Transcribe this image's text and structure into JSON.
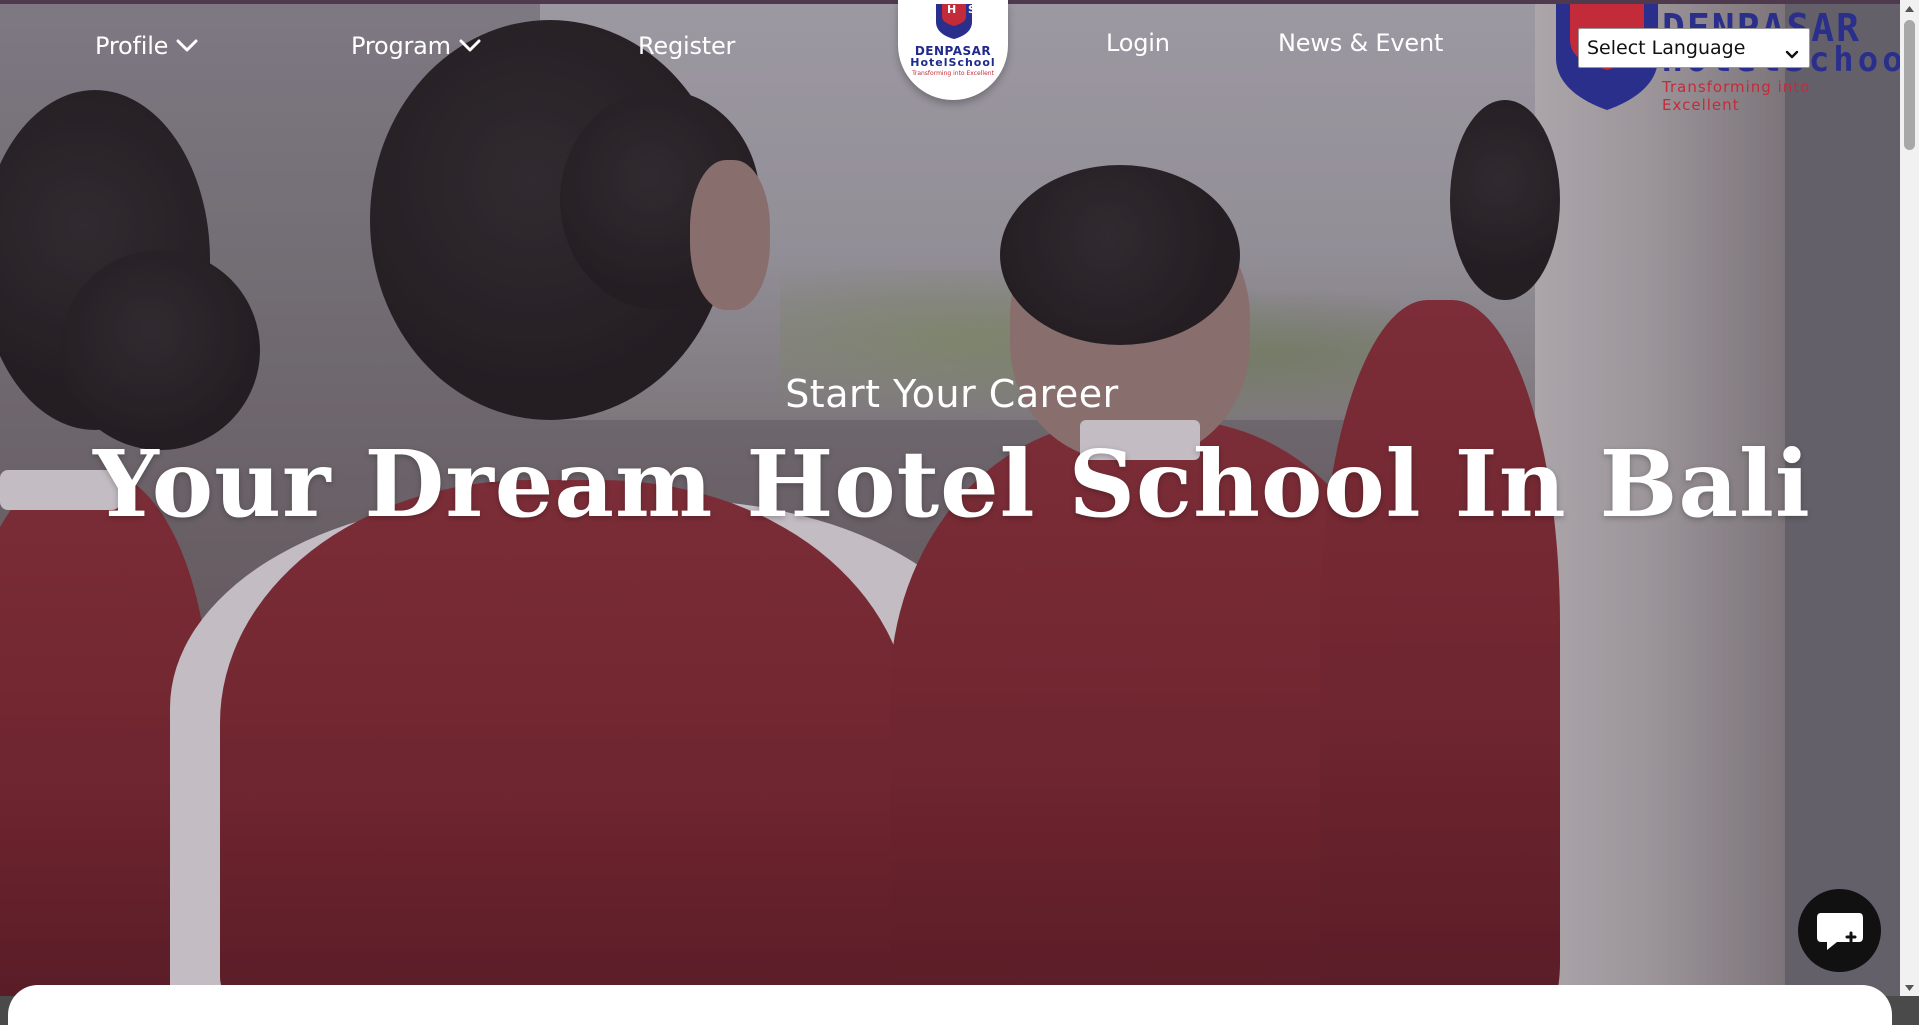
{
  "nav": {
    "profile_label": "Profile",
    "program_label": "Program",
    "register_label": "Register",
    "login_label": "Login",
    "news_label": "News & Event"
  },
  "logo_center": {
    "crest_letters": "D H S",
    "line1": "DENPASAR",
    "line2": "HotelSchool",
    "tagline": "Transforming into Excellent"
  },
  "logo_right": {
    "line1": "DENPASAR",
    "line2": "HotelSchool",
    "tagline": "Transforming into Excellent"
  },
  "language": {
    "selected": "Select Language"
  },
  "hero": {
    "subtitle": "Start Your Career",
    "headline": "Your Dream Hotel School In Bali"
  },
  "colors": {
    "brand_navy": "#2b2f8c",
    "brand_red": "#c42b3a",
    "jacket_maroon": "#7a1f28"
  },
  "icons": {
    "chat": "chat-bubble-plus-icon",
    "dropdown": "chevron-down-icon"
  }
}
